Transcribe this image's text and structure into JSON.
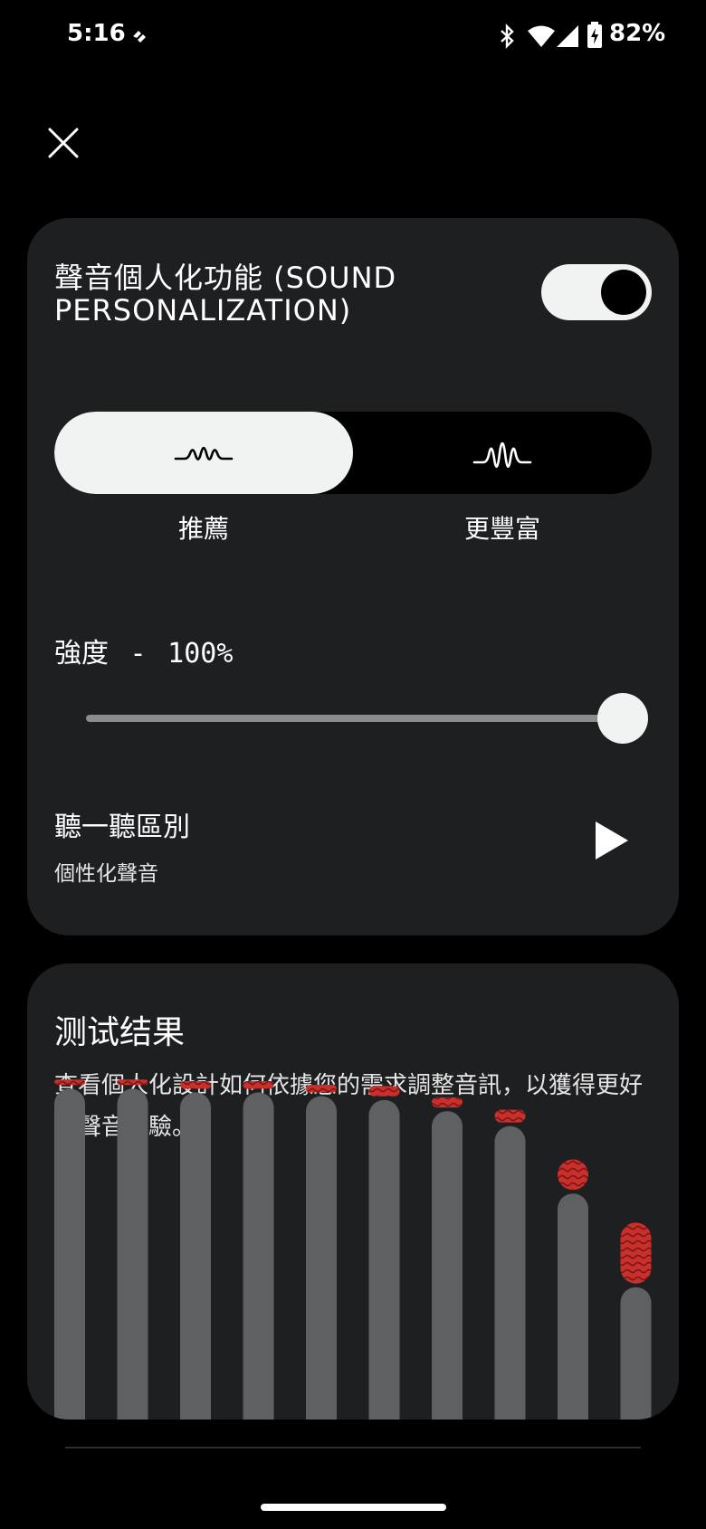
{
  "status": {
    "time": "5:16",
    "battery": "82%",
    "icons": [
      "data-saver-icon",
      "bluetooth-icon",
      "wifi-icon",
      "signal-icon",
      "battery-charging-icon"
    ]
  },
  "close_icon": "close-icon",
  "personalization": {
    "title": "聲音個人化功能 (SOUND PERSONALIZATION)",
    "toggle_on": true,
    "options": [
      {
        "label": "推薦",
        "icon": "soft-wave-icon",
        "selected": true
      },
      {
        "label": "更豐富",
        "icon": "rich-wave-icon",
        "selected": false
      }
    ],
    "intensity_label": "強度",
    "intensity_sep": "-",
    "intensity_value": "100%",
    "intensity_level": 1.0,
    "listen_title": "聽一聽區別",
    "listen_subtitle": "個性化聲音",
    "play_icon": "play-icon"
  },
  "results": {
    "title": "测试结果",
    "description": "查看個人化設計如何依據您的需求調整音訊，以獲得更好的聲音體驗。",
    "levels": [
      0.98,
      0.98,
      0.97,
      0.97,
      0.96,
      0.95,
      0.92,
      0.88,
      0.7,
      0.45
    ],
    "adjust": [
      0.02,
      0.02,
      0.03,
      0.03,
      0.03,
      0.04,
      0.04,
      0.05,
      0.12,
      0.24
    ],
    "colors": {
      "bar": "#5f6062",
      "adjust": "#c9302c",
      "card": "#1e1f21"
    }
  }
}
